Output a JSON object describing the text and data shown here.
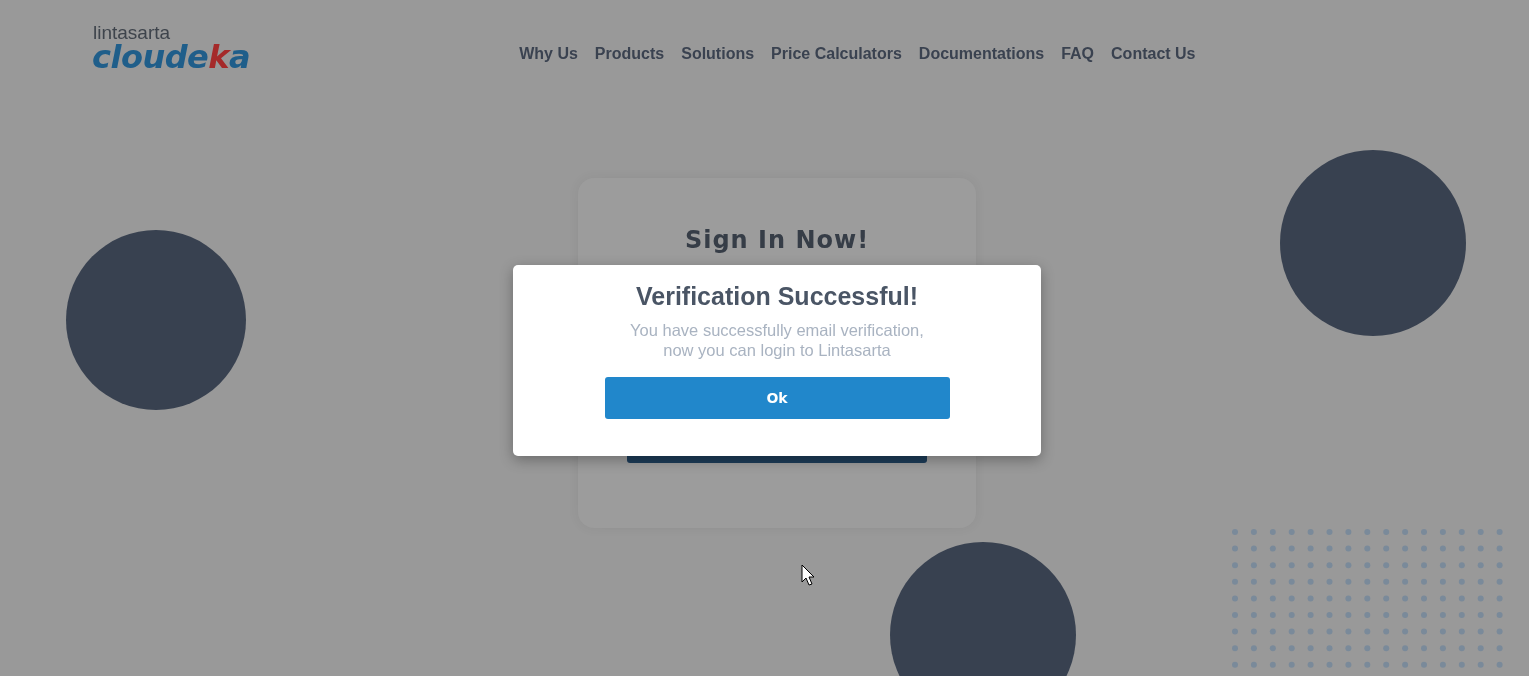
{
  "logo": {
    "top": "lintasarta",
    "parts": [
      {
        "text": "cloude",
        "accent": false
      },
      {
        "text": "k",
        "accent": true
      },
      {
        "text": "a",
        "accent": false
      }
    ]
  },
  "nav": [
    "Why Us",
    "Products",
    "Solutions",
    "Price Calculators",
    "Documentations",
    "FAQ",
    "Contact Us"
  ],
  "card": {
    "title": "Sign In Now!"
  },
  "modal": {
    "title": "Verification Successful!",
    "message_lines": [
      "You have successfully email verification,",
      "now you can login to Lintasarta"
    ],
    "button": "Ok"
  }
}
